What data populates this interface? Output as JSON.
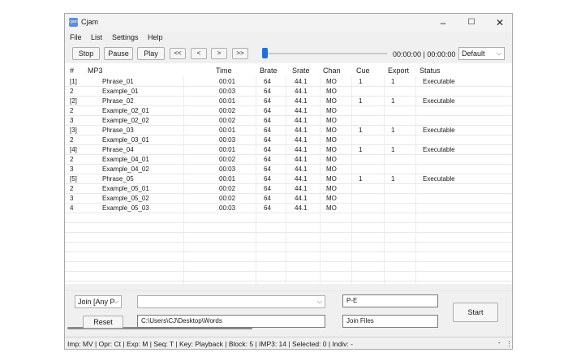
{
  "window": {
    "title": "Cjam",
    "icon_label": "cjam"
  },
  "menu": [
    "File",
    "List",
    "Settings",
    "Help"
  ],
  "toolbar": {
    "stop": "Stop",
    "pause": "Pause",
    "play": "Play",
    "nav": [
      "<<",
      "<",
      ">",
      ">>"
    ],
    "timecode": "00:00:00 | 00:00:00",
    "profile": "Default",
    "progress": 0
  },
  "columns": [
    "#",
    "MP3",
    "Time",
    "Brate",
    "Srate",
    "Chan",
    "Cue",
    "Export",
    "Status"
  ],
  "rows": [
    [
      "[1]",
      "Phrase_01",
      "00:01",
      "64",
      "44.1",
      "MO",
      "1",
      "1",
      "Executable"
    ],
    [
      "2",
      "Example_01",
      "00:03",
      "64",
      "44.1",
      "MO",
      "",
      "",
      ""
    ],
    [
      "[2]",
      "Phrase_02",
      "00:01",
      "64",
      "44.1",
      "MO",
      "1",
      "1",
      "Executable"
    ],
    [
      "2",
      "Example_02_01",
      "00:02",
      "64",
      "44.1",
      "MO",
      "",
      "",
      ""
    ],
    [
      "3",
      "Example_02_02",
      "00:02",
      "64",
      "44.1",
      "MO",
      "",
      "",
      ""
    ],
    [
      "[3]",
      "Phrase_03",
      "00:01",
      "64",
      "44.1",
      "MO",
      "1",
      "1",
      "Executable"
    ],
    [
      "2",
      "Example_03_01",
      "00:03",
      "64",
      "44.1",
      "MO",
      "",
      "",
      ""
    ],
    [
      "[4]",
      "Phrase_04",
      "00:01",
      "64",
      "44.1",
      "MO",
      "1",
      "1",
      "Executable"
    ],
    [
      "2",
      "Example_04_01",
      "00:02",
      "64",
      "44.1",
      "MO",
      "",
      "",
      ""
    ],
    [
      "3",
      "Example_04_02",
      "00:03",
      "64",
      "44.1",
      "MO",
      "",
      "",
      ""
    ],
    [
      "[5]",
      "Phrase_05",
      "00:01",
      "64",
      "44.1",
      "MO",
      "1",
      "1",
      "Executable"
    ],
    [
      "2",
      "Example_05_01",
      "00:02",
      "64",
      "44.1",
      "MO",
      "",
      "",
      ""
    ],
    [
      "3",
      "Example_05_02",
      "00:02",
      "64",
      "44.1",
      "MO",
      "",
      "",
      ""
    ],
    [
      "4",
      "Example_05_03",
      "00:03",
      "64",
      "44.1",
      "MO",
      "",
      "",
      ""
    ]
  ],
  "bottom": {
    "join_mode": "Join [Any P",
    "middle_select": "",
    "pe_value": "P-E",
    "reset": "Reset",
    "path": "C:\\Users\\CJ\\Desktop\\Words",
    "join_files": "Join Files",
    "start": "Start"
  },
  "status": [
    "Imp: MV",
    "Opr: Ct",
    "Exp: M",
    "Seq: T",
    "Key: Playback",
    "Block: 5",
    "IMP3: 14",
    "Selected: 0",
    "Indiv: -"
  ],
  "colors": {
    "accent": "#1e6fd9",
    "window_bg": "#f0f0f0",
    "list_bg": "#ffffff"
  }
}
